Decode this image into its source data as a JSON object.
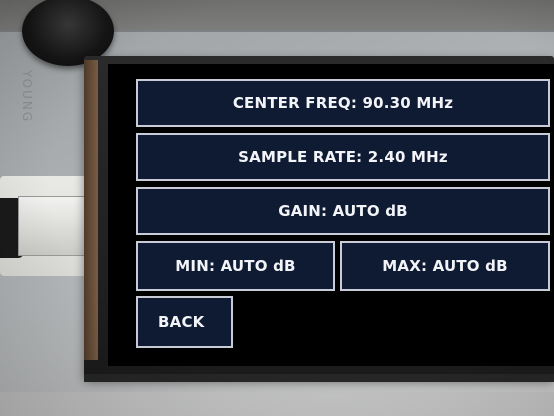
{
  "scene": {
    "brand_text": "YOUNG"
  },
  "screen": {
    "center_freq": "CENTER FREQ: 90.30 MHz",
    "sample_rate": "SAMPLE RATE: 2.40 MHz",
    "gain": "GAIN: AUTO dB",
    "min": "MIN: AUTO dB",
    "max": "MAX: AUTO dB",
    "back": "BACK"
  },
  "colors": {
    "button_fill": "#0f1a33",
    "button_border": "#c9ccd6",
    "text": "#f2f4f8"
  }
}
